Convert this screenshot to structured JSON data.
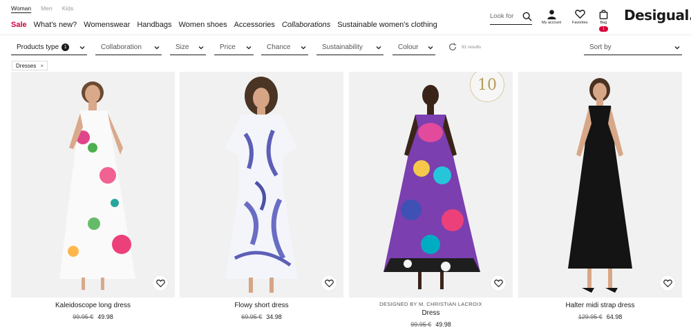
{
  "header": {
    "gender_tabs": [
      "Woman",
      "Men",
      "Kids"
    ],
    "nav": [
      "Sale",
      "What's new?",
      "Womenswear",
      "Handbags",
      "Women shoes",
      "Accessories",
      "Collaborations",
      "Sustainable women's clothing"
    ],
    "search_placeholder": "Look for",
    "my_account": "My account",
    "favorites": "Favorites",
    "bag": "Bag",
    "bag_count": "1",
    "logo": "Desigual."
  },
  "filters": {
    "items": [
      "Products type",
      "Collaboration",
      "Size",
      "Price",
      "Chance",
      "Sustainability",
      "Colour"
    ],
    "products_type_count": "1",
    "results": "91 results",
    "sort_by": "Sort by"
  },
  "active_chip": {
    "label": "Dresses",
    "remove": "×"
  },
  "products": [
    {
      "designer": "",
      "name": "Kaleidoscope long dress",
      "old_price": "99.95 €",
      "new_price": "49.98"
    },
    {
      "designer": "",
      "name": "Flowy short dress",
      "old_price": "69.95 €",
      "new_price": "34.98"
    },
    {
      "designer": "DESIGNED BY M. CHRISTIAN LACROIX",
      "name": "Dress",
      "old_price": "99.95 €",
      "new_price": "49.98",
      "badge": "10"
    },
    {
      "designer": "",
      "name": "Halter midi strap dress",
      "old_price": "129.95 €",
      "new_price": "64.98"
    }
  ],
  "colors": {
    "accent": "#d6003a",
    "text": "#1a1a1a",
    "photo_bg": "#f1f1f1"
  },
  "icons": [
    "search-icon",
    "user-icon",
    "heart-icon",
    "bag-icon",
    "chevron-down-icon",
    "refresh-icon",
    "close-icon"
  ]
}
